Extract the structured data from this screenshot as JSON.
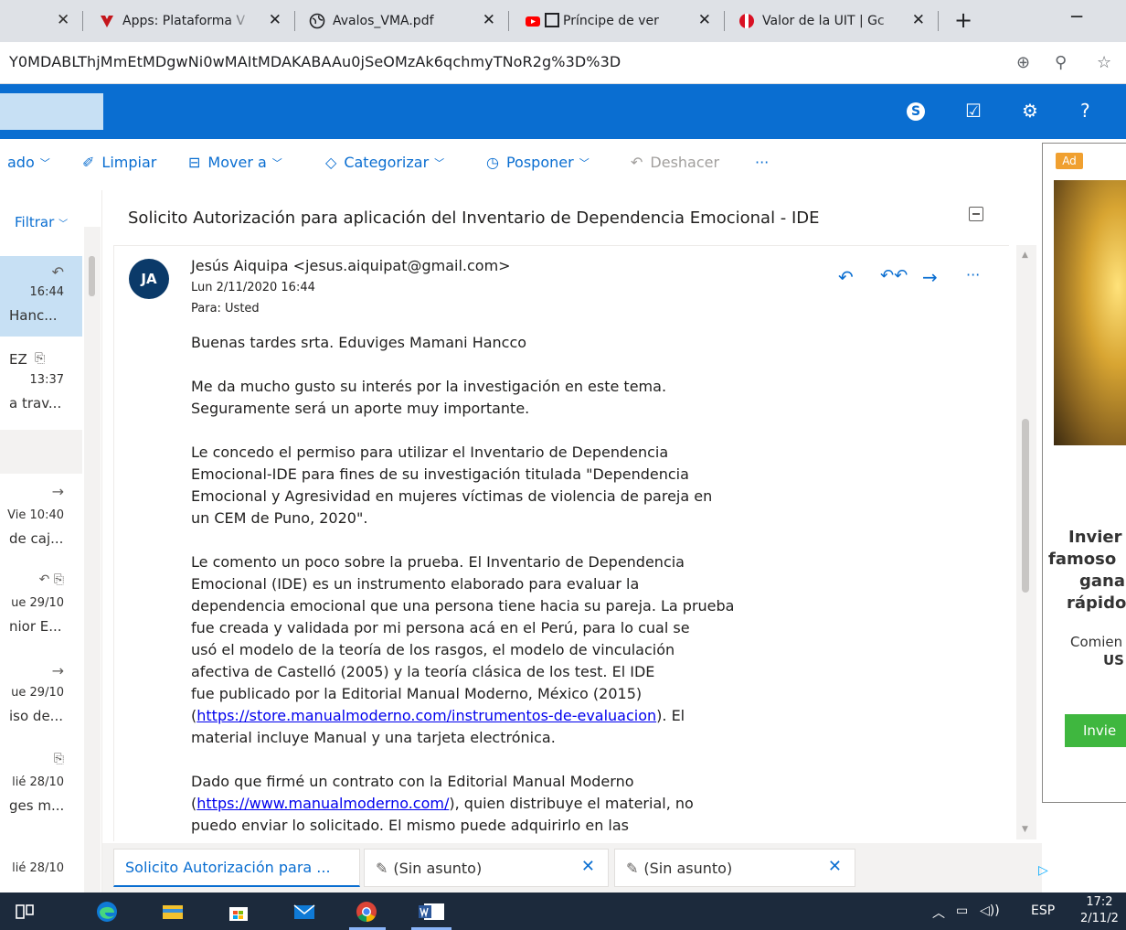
{
  "browser": {
    "tabs": [
      {
        "title": "Apps: Plataforma V",
        "icon": "university-icon"
      },
      {
        "title": "Avalos_VMA.pdf",
        "icon": "globe-icon"
      },
      {
        "title": "Príncipe de ver",
        "icon": "youtube-icon"
      },
      {
        "title": "Valor de la UIT | Gc",
        "icon": "peru-flag-icon"
      }
    ],
    "new_tab": "+",
    "minimize": "─",
    "url": "Y0MDABLThjMmEtMDgwNi0wMAItMDAKABAAu0jSeOMzAk6qchmyTNoR2g%3D%3D"
  },
  "commands": {
    "marked": "ado",
    "sweep": "Limpiar",
    "move": "Mover a",
    "categorize": "Categorizar",
    "snooze": "Posponer",
    "undo": "Deshacer",
    "more": "···"
  },
  "message_list": {
    "filter": "Filtrar",
    "items": [
      {
        "time": "16:44",
        "preview": "Hanc..."
      },
      {
        "sender": "EZ",
        "time": "13:37",
        "preview": "a trav..."
      },
      {
        "time": "Vie 10:40",
        "preview": "de caj..."
      },
      {
        "time": "ue 29/10",
        "preview": "nior E..."
      },
      {
        "time": "ue 29/10",
        "preview": "iso de..."
      },
      {
        "time": "lié 28/10",
        "preview": "ges m..."
      },
      {
        "time": "lié 28/10"
      }
    ]
  },
  "message": {
    "subject": "Solicito Autorización para aplicación del Inventario de Dependencia Emocional - IDE",
    "avatar_initials": "JA",
    "from": "Jesús Aiquipa <jesus.aiquipat@gmail.com>",
    "date": "Lun 2/11/2020 16:44",
    "to": "Para:  Usted",
    "body": {
      "greeting": "Buenas tardes srta. Eduviges Mamani Hancco",
      "p1_l1": "Me da mucho gusto su interés por la investigación en este tema.",
      "p1_l2": "Seguramente será un  aporte muy importante.",
      "p2_l1": "Le concedo el permiso para utilizar el Inventario de Dependencia",
      "p2_l2": "Emocional-IDE para fines de su investigación titulada \"Dependencia",
      "p2_l3": "Emocional y Agresividad en mujeres víctimas de violencia de pareja en",
      "p2_l4": "un CEM de Puno, 2020\".",
      "p3_l1": "Le comento un poco sobre la prueba. El Inventario de Dependencia",
      "p3_l2": "Emocional (IDE) es un instrumento elaborado para evaluar la",
      "p3_l3": "dependencia emocional que una persona tiene hacia su pareja. La prueba",
      "p3_l4": "fue creada y validada por mi persona acá en el Perú, para lo cual se",
      "p3_l5": "usó el modelo de la teoría de los rasgos, el modelo de vinculación",
      "p3_l6": "afectiva de Castelló (2005) y la teoría clásica de los test. El IDE",
      "p3_l7": "fue publicado por la Editorial Manual Moderno, México (2015)",
      "p3_l8_pre": "(",
      "p3_link": "https://store.manualmoderno.com/instrumentos-de-evaluacion",
      "p3_l8_post": "). El",
      "p3_l9": "material incluye Manual y una tarjeta electrónica.",
      "p4_l1": "Dado que firmé un contrato con la Editorial Manual Moderno",
      "p4_l2_pre": "(",
      "p4_link": "https://www.manualmoderno.com/",
      "p4_l2_post": "), quien distribuye el material, no",
      "p4_l3": "puedo enviar lo solicitado. El mismo puede adquirirlo en las"
    }
  },
  "drafts": [
    {
      "label": "Solicito Autorización para ..."
    },
    {
      "label": "(Sin asunto)"
    },
    {
      "label": "(Sin asunto)"
    }
  ],
  "ad": {
    "badge": "Ad",
    "l1": "Invier",
    "l2": "famoso",
    "l3": "gana",
    "l4": "rápido",
    "l5": "Comien",
    "l6": "US",
    "button": "Invie"
  },
  "taskbar": {
    "lang": "ESP",
    "time": "17:2",
    "date": "2/11/2"
  },
  "colors": {
    "accent": "#0a6ed1",
    "selected": "#c7e0f4",
    "avatar": "#0b3a69",
    "taskbar": "#1c2a3c"
  }
}
